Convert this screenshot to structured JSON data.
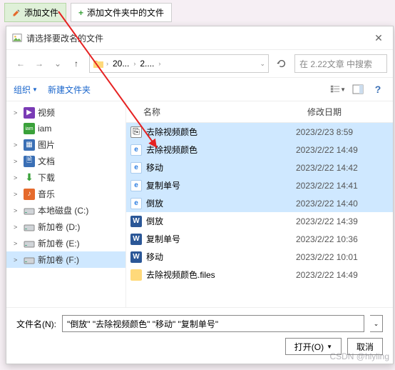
{
  "app_tabs": {
    "add_file": "添加文件",
    "add_folder_files": "添加文件夹中的文件"
  },
  "dialog": {
    "title": "请选择要改名的文件",
    "breadcrumb": {
      "seg1": "20...",
      "seg2": "2...."
    },
    "search_placeholder": "在 2.22文章 中搜索",
    "toolbar": {
      "organize": "组织",
      "new_folder": "新建文件夹"
    },
    "columns": {
      "name": "名称",
      "modified": "修改日期"
    },
    "sidebar": [
      {
        "label": "视频",
        "icon": "video",
        "caret": ">"
      },
      {
        "label": "iam",
        "icon": "iam",
        "caret": ""
      },
      {
        "label": "图片",
        "icon": "image",
        "caret": ">"
      },
      {
        "label": "文档",
        "icon": "doc",
        "caret": ">"
      },
      {
        "label": "下载",
        "icon": "download",
        "caret": ">"
      },
      {
        "label": "音乐",
        "icon": "music",
        "caret": ">"
      },
      {
        "label": "本地磁盘 (C:)",
        "icon": "disk",
        "caret": ">"
      },
      {
        "label": "新加卷 (D:)",
        "icon": "disk",
        "caret": ">"
      },
      {
        "label": "新加卷 (E:)",
        "icon": "disk",
        "caret": ">"
      },
      {
        "label": "新加卷 (F:)",
        "icon": "disk",
        "caret": ">",
        "selected": true
      }
    ],
    "files": [
      {
        "name": "去除视频颜色",
        "date": "2023/2/23 8:59",
        "icon": "lnk",
        "selected": true
      },
      {
        "name": "去除视频颜色",
        "date": "2023/2/22 14:49",
        "icon": "ie",
        "selected": true
      },
      {
        "name": "移动",
        "date": "2023/2/22 14:42",
        "icon": "ie",
        "selected": true
      },
      {
        "name": "复制单号",
        "date": "2023/2/22 14:41",
        "icon": "ie",
        "selected": true
      },
      {
        "name": "倒放",
        "date": "2023/2/22 14:40",
        "icon": "ie",
        "selected": true
      },
      {
        "name": "倒放",
        "date": "2023/2/22 14:39",
        "icon": "word"
      },
      {
        "name": "复制单号",
        "date": "2023/2/22 10:36",
        "icon": "word"
      },
      {
        "name": "移动",
        "date": "2023/2/22 10:01",
        "icon": "word"
      },
      {
        "name": "去除视频颜色.files",
        "date": "2023/2/22 14:49",
        "icon": "folder"
      }
    ],
    "filename_label": "文件名(N):",
    "filename_value": "\"倒放\" \"去除视频颜色\" \"移动\" \"复制单号\"",
    "open_btn": "打开(O)",
    "cancel_btn": "取消"
  },
  "watermark": "CSDN @hlyling"
}
